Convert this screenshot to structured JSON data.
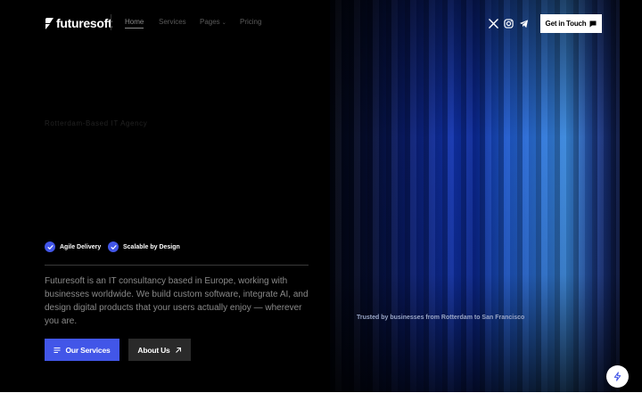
{
  "brand": {
    "name": "futuresoft",
    "accent": "#4256e8"
  },
  "nav": {
    "items": [
      {
        "label": "Home",
        "active": true
      },
      {
        "label": "Services"
      },
      {
        "label": "Pages"
      },
      {
        "label": "Pricing"
      }
    ]
  },
  "header": {
    "social": [
      "x-icon",
      "instagram-icon",
      "telegram-icon"
    ],
    "cta_label": "Get in Touch"
  },
  "hero": {
    "kicker": "Rotterdam-Based IT Agency",
    "features": [
      "Agile Delivery",
      "Scalable by Design"
    ],
    "description": "Futuresoft is an IT consultancy based in Europe, working with businesses worldwide. We build custom software, integrate AI, and design digital products that your users actually enjoy — wherever you are.",
    "primary_button": "Our Services",
    "secondary_button": "About Us",
    "trusted_text": "Trusted by businesses from Rotterdam to San Francisco"
  },
  "fab": {
    "icon": "lightning-icon"
  }
}
